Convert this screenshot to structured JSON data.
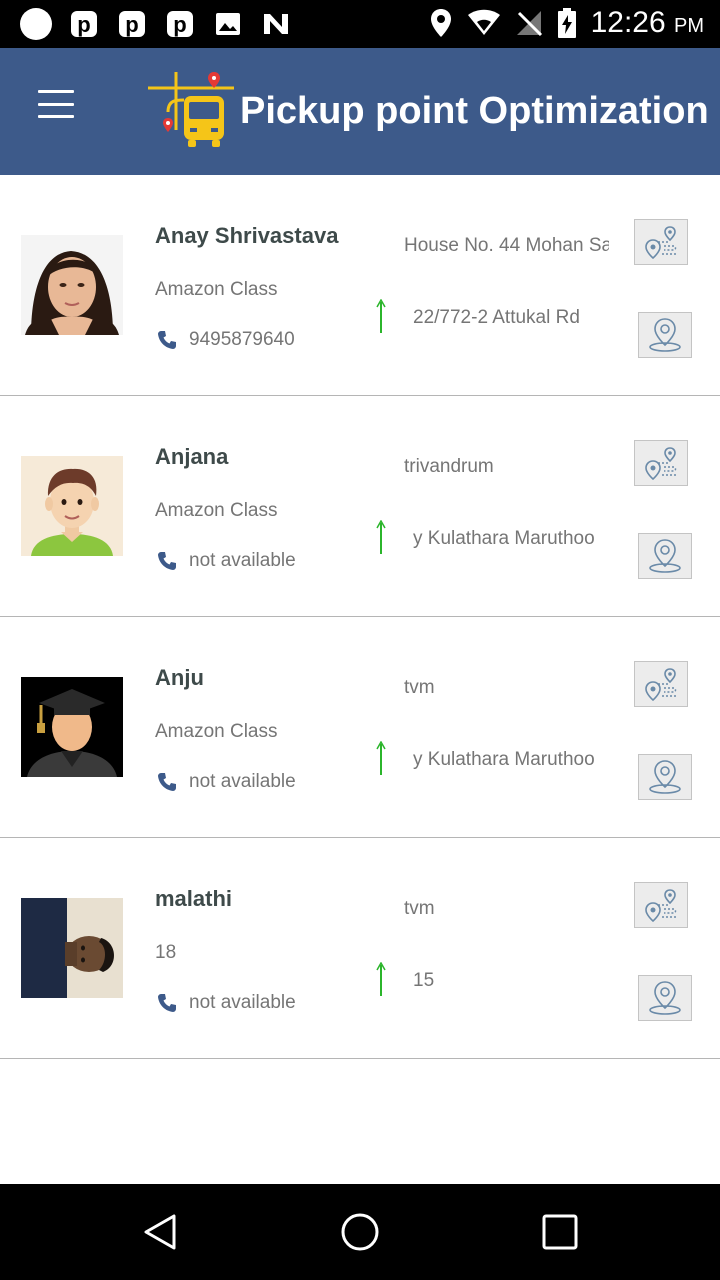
{
  "status_bar": {
    "time": "12:26",
    "ampm": "PM",
    "icons": [
      "circle-icon",
      "p-app-icon",
      "p-app-icon",
      "p-app-icon",
      "image-icon",
      "n-app-icon",
      "location-icon",
      "wifi-icon",
      "no-signal-icon",
      "battery-charging-icon"
    ]
  },
  "app_bar": {
    "title": "Pickup point Optimization",
    "menu_icon": "hamburger-menu-icon",
    "logo_icon": "bus-route-logo-icon",
    "color": "#3d5a8a"
  },
  "students": [
    {
      "name": "Anay Shrivastava",
      "class": "Amazon Class",
      "phone": "9495879640",
      "address_line1": "House No. 44 Mohan Sa",
      "address_line2": "22/772-2  Attukal Rd",
      "avatar": "woman-photo"
    },
    {
      "name": "Anjana",
      "class": "Amazon Class",
      "phone": "not available",
      "address_line1": "trivandrum",
      "address_line2": "y Kulathara Maruthoo",
      "avatar": "cartoon-man"
    },
    {
      "name": "Anju",
      "class": "Amazon Class",
      "phone": "not available",
      "address_line1": "tvm",
      "address_line2": "y Kulathara Maruthoo",
      "avatar": "graduate-silhouette"
    },
    {
      "name": "malathi",
      "class": "18",
      "phone": "not available",
      "address_line1": "tvm",
      "address_line2": "15",
      "avatar": "rotated-man-photo"
    }
  ],
  "colors": {
    "arrow_green": "#2bb52b",
    "phone_blue": "#3d5a8a",
    "name_text": "#3e4a4a"
  }
}
